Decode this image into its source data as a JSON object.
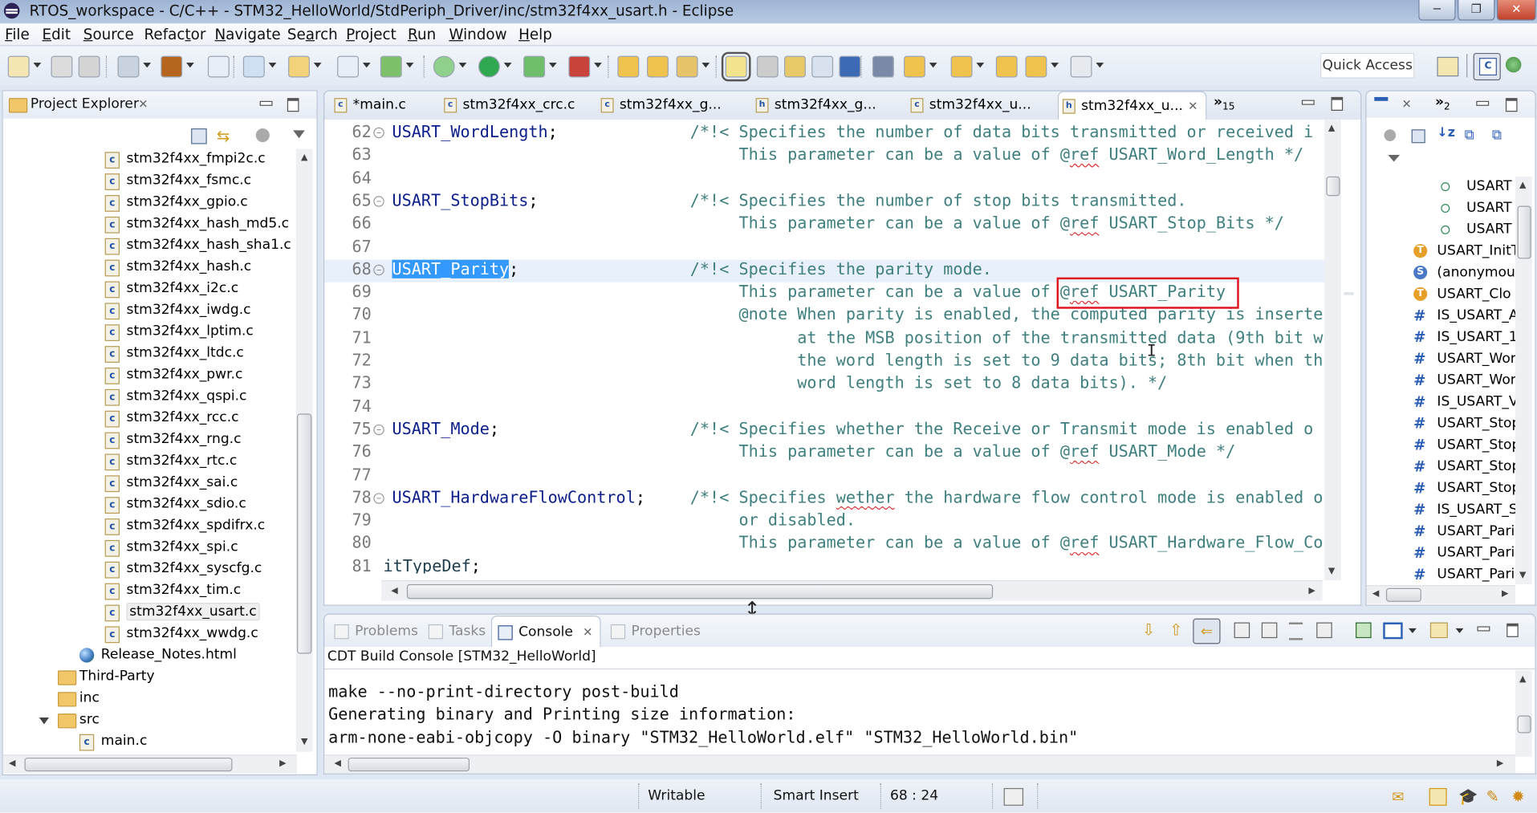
{
  "window": {
    "title": "RTOS_workspace - C/C++ - STM32_HelloWorld/StdPeriph_Driver/inc/stm32f4xx_usart.h - Eclipse",
    "controls": {
      "minimize": "minimize-icon",
      "restore": "restore-icon",
      "close": "close-icon"
    }
  },
  "menubar": {
    "items": [
      {
        "label": "File",
        "mnemonic": "F"
      },
      {
        "label": "Edit",
        "mnemonic": "E"
      },
      {
        "label": "Source",
        "mnemonic": "S"
      },
      {
        "label": "Refactor",
        "mnemonic": "t"
      },
      {
        "label": "Navigate",
        "mnemonic": "N"
      },
      {
        "label": "Search",
        "mnemonic": "a"
      },
      {
        "label": "Project",
        "mnemonic": "P"
      },
      {
        "label": "Run",
        "mnemonic": "R"
      },
      {
        "label": "Window",
        "mnemonic": "W"
      },
      {
        "label": "Help",
        "mnemonic": "H"
      }
    ]
  },
  "toolbar": {
    "icons": [
      "new-icon",
      "save-icon",
      "save-all-icon",
      "manage-configurations-icon",
      "build-icon",
      "build-all-icon",
      "new-c-project-icon",
      "new-source-folder-icon",
      "new-source-file-icon",
      "new-class-icon",
      "debug-icon",
      "run-icon",
      "run-configurations-icon",
      "external-tools-icon",
      "open-type-icon",
      "open-element-icon",
      "search-icon",
      "toggle-mark-occurrences-icon",
      "toggle-breadcrumb-icon",
      "toggle-word-wrap-icon",
      "block-selection-icon",
      "show-whitespace-icon",
      "pin-icon",
      "next-annotation-icon",
      "previous-annotation-icon",
      "last-edit-location-icon",
      "back-icon",
      "forward-icon"
    ],
    "quick_access": "Quick Access",
    "perspectives": [
      "open-perspective-icon",
      "c-cpp-perspective-icon",
      "debug-perspective-icon"
    ]
  },
  "project_explorer": {
    "title": "Project Explorer",
    "items": [
      {
        "label": "stm32f4xx_fmpi2c.c",
        "type": "c-file"
      },
      {
        "label": "stm32f4xx_fsmc.c",
        "type": "c-file"
      },
      {
        "label": "stm32f4xx_gpio.c",
        "type": "c-file"
      },
      {
        "label": "stm32f4xx_hash_md5.c",
        "type": "c-file"
      },
      {
        "label": "stm32f4xx_hash_sha1.c",
        "type": "c-file"
      },
      {
        "label": "stm32f4xx_hash.c",
        "type": "c-file"
      },
      {
        "label": "stm32f4xx_i2c.c",
        "type": "c-file"
      },
      {
        "label": "stm32f4xx_iwdg.c",
        "type": "c-file"
      },
      {
        "label": "stm32f4xx_lptim.c",
        "type": "c-file"
      },
      {
        "label": "stm32f4xx_ltdc.c",
        "type": "c-file"
      },
      {
        "label": "stm32f4xx_pwr.c",
        "type": "c-file"
      },
      {
        "label": "stm32f4xx_qspi.c",
        "type": "c-file"
      },
      {
        "label": "stm32f4xx_rcc.c",
        "type": "c-file"
      },
      {
        "label": "stm32f4xx_rng.c",
        "type": "c-file"
      },
      {
        "label": "stm32f4xx_rtc.c",
        "type": "c-file"
      },
      {
        "label": "stm32f4xx_sai.c",
        "type": "c-file"
      },
      {
        "label": "stm32f4xx_sdio.c",
        "type": "c-file"
      },
      {
        "label": "stm32f4xx_spdifrx.c",
        "type": "c-file"
      },
      {
        "label": "stm32f4xx_spi.c",
        "type": "c-file"
      },
      {
        "label": "stm32f4xx_syscfg.c",
        "type": "c-file"
      },
      {
        "label": "stm32f4xx_tim.c",
        "type": "c-file"
      },
      {
        "label": "stm32f4xx_usart.c",
        "type": "c-file",
        "selected": true
      },
      {
        "label": "stm32f4xx_wwdg.c",
        "type": "c-file"
      },
      {
        "label": "Release_Notes.html",
        "type": "html-file"
      },
      {
        "label": "Third-Party",
        "type": "folder"
      },
      {
        "label": "inc",
        "type": "folder"
      },
      {
        "label": "src",
        "type": "folder",
        "expanded": true
      },
      {
        "label": "main.c",
        "type": "c-file"
      }
    ]
  },
  "editor": {
    "tabs": [
      {
        "label": "*main.c",
        "type": "c"
      },
      {
        "label": "stm32f4xx_crc.c",
        "type": "c"
      },
      {
        "label": "stm32f4xx_g...",
        "type": "c"
      },
      {
        "label": "stm32f4xx_g...",
        "type": "h"
      },
      {
        "label": "stm32f4xx_u...",
        "type": "c"
      },
      {
        "label": "stm32f4xx_u...",
        "type": "h",
        "active": true
      }
    ],
    "overflow_count": "15",
    "lines": [
      {
        "num": "62",
        "fold": true,
        "code": "USART_WordLength;",
        "comment": "/*!< Specifies the number of data bits transmitted or received i"
      },
      {
        "num": "63",
        "code": "",
        "comment": "     This parameter can be a value of @ref USART_Word_Length */"
      },
      {
        "num": "64",
        "code": "",
        "comment": ""
      },
      {
        "num": "65",
        "fold": true,
        "code": "USART_StopBits;",
        "comment": "/*!< Specifies the number of stop bits transmitted."
      },
      {
        "num": "66",
        "code": "",
        "comment": "     This parameter can be a value of @ref USART_Stop_Bits */"
      },
      {
        "num": "67",
        "code": "",
        "comment": ""
      },
      {
        "num": "68",
        "fold": true,
        "code": "USART_Parity;",
        "comment": "/*!< Specifies the parity mode.",
        "current": true
      },
      {
        "num": "69",
        "code": "",
        "comment": "     This parameter can be a value of @ref USART_Parity"
      },
      {
        "num": "70",
        "code": "",
        "comment": "     @note When parity is enabled, the computed parity is inserte"
      },
      {
        "num": "71",
        "code": "",
        "comment": "           at the MSB position of the transmitted data (9th bit w"
      },
      {
        "num": "72",
        "code": "",
        "comment": "           the word length is set to 9 data bits; 8th bit when th"
      },
      {
        "num": "73",
        "code": "",
        "comment": "           word length is set to 8 data bits). */"
      },
      {
        "num": "74",
        "code": "",
        "comment": ""
      },
      {
        "num": "75",
        "fold": true,
        "code": "USART_Mode;",
        "comment": "/*!< Specifies whether the Receive or Transmit mode is enabled o"
      },
      {
        "num": "76",
        "code": "",
        "comment": "     This parameter can be a value of @ref USART_Mode */"
      },
      {
        "num": "77",
        "code": "",
        "comment": ""
      },
      {
        "num": "78",
        "fold": true,
        "code": "USART_HardwareFlowControl;",
        "comment": "/*!< Specifies wether the hardware flow control mode is enabled o"
      },
      {
        "num": "79",
        "code": "",
        "comment": "     or disabled."
      },
      {
        "num": "80",
        "code": "",
        "comment": "     This parameter can be a value of @ref USART_Hardware_Flow_Co"
      },
      {
        "num": "81",
        "code": "itTypeDef;",
        "comment": ""
      }
    ],
    "selection": "USART_Parity",
    "highlighted_ref": "@ref USART_Parity"
  },
  "outline": {
    "items": [
      {
        "label": "USART",
        "icon": "field"
      },
      {
        "label": "USART",
        "icon": "field"
      },
      {
        "label": "USART",
        "icon": "field"
      },
      {
        "label": "USART_InitT",
        "icon": "typedef"
      },
      {
        "label": "(anonymous",
        "icon": "struct"
      },
      {
        "label": "USART_Clo",
        "icon": "typedef"
      },
      {
        "label": "IS_USART_A",
        "icon": "macro"
      },
      {
        "label": "IS_USART_1",
        "icon": "macro"
      },
      {
        "label": "USART_Wor",
        "icon": "macro"
      },
      {
        "label": "USART_Wor",
        "icon": "macro"
      },
      {
        "label": "IS_USART_V",
        "icon": "macro"
      },
      {
        "label": "USART_Stop",
        "icon": "macro"
      },
      {
        "label": "USART_Stop",
        "icon": "macro"
      },
      {
        "label": "USART_Stop",
        "icon": "macro"
      },
      {
        "label": "USART_Stop",
        "icon": "macro"
      },
      {
        "label": "IS_USART_S",
        "icon": "macro"
      },
      {
        "label": "USART_Pari",
        "icon": "macro"
      },
      {
        "label": "USART_Pari",
        "icon": "macro"
      },
      {
        "label": "USART_Pari",
        "icon": "macro"
      }
    ],
    "tab2_count": "2"
  },
  "bottom_panel": {
    "tabs": [
      {
        "label": "Problems",
        "icon": "problems-icon"
      },
      {
        "label": "Tasks",
        "icon": "tasks-icon"
      },
      {
        "label": "Console",
        "icon": "console-icon",
        "active": true
      },
      {
        "label": "Properties",
        "icon": "properties-icon"
      }
    ],
    "console_title": "CDT Build Console [STM32_HelloWorld]",
    "console_lines": [
      "make --no-print-directory post-build",
      "Generating binary and Printing size information:",
      "arm-none-eabi-objcopy -O binary \"STM32_HelloWorld.elf\" \"STM32_HelloWorld.bin\""
    ]
  },
  "statusbar": {
    "writable": "Writable",
    "insert_mode": "Smart Insert",
    "cursor_position": "68 : 24"
  },
  "colors": {
    "selection": "#3399ff",
    "highlight_box": "#e0141e",
    "keyword": "#0b1e8a",
    "comment": "#3f7f7f"
  }
}
